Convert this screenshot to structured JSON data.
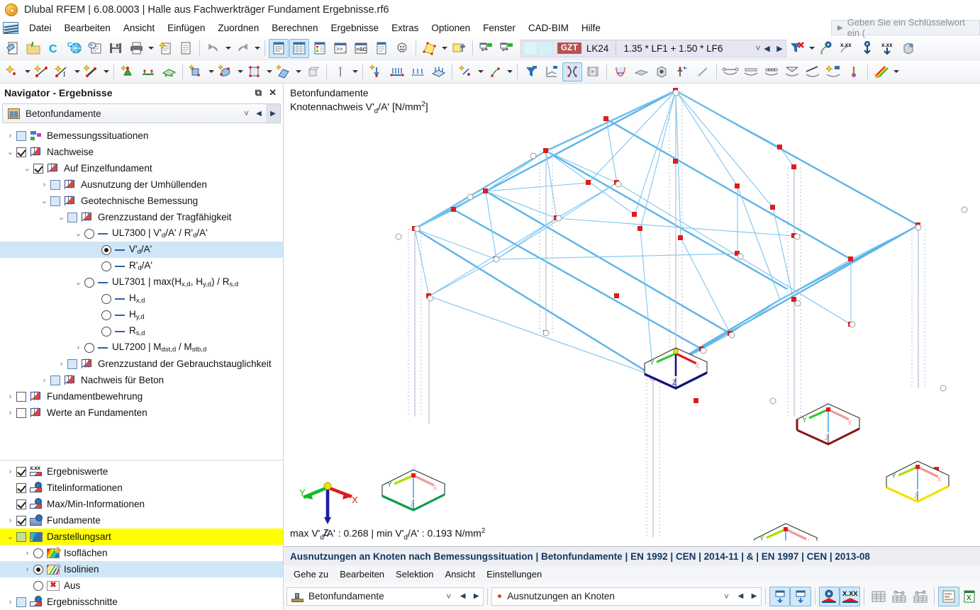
{
  "window": {
    "title": "Dlubal RFEM | 6.08.0003 | Halle aus Fachwerkträger Fundament Ergebnisse.rf6",
    "logo_icon": "dlubal-logo-icon"
  },
  "menubar": {
    "app_icon": "rfem-app-icon",
    "items": [
      "Datei",
      "Bearbeiten",
      "Ansicht",
      "Einfügen",
      "Zuordnen",
      "Berechnen",
      "Ergebnisse",
      "Extras",
      "Optionen",
      "Fenster",
      "CAD-BIM",
      "Hilfe"
    ],
    "search_placeholder": "Geben Sie ein Schlüsselwort ein ("
  },
  "toolbar1": {
    "icons": [
      "new-model-icon",
      "open-folder-icon",
      "connect-icon",
      "cloud-model-icon",
      "model-info-icon",
      "save-icon",
      "print-icon",
      "print-dropdown-caret",
      "new-report-icon",
      "document-icon",
      "undo-icon",
      "undo-dropdown-caret",
      "redo-icon",
      "redo-dropdown-caret",
      "navigator-panel-icon",
      "table-panel-icon",
      "colors-panel-icon",
      "console-icon",
      "script-icon",
      "list-panel-icon",
      "support-icon",
      "render-model-icon",
      "render-dropdown-caret",
      "loads-toggle-icon"
    ],
    "load_combo": {
      "category_badge": "GZT",
      "combination": "LK24",
      "formula": "1.35 * LF1 + 1.50 * LF6",
      "chevron": "chevron-down-icon",
      "prev": "prev-combination-icon",
      "next": "next-combination-icon"
    },
    "right_icons": [
      "filter-clear-icon",
      "filter-dropdown-caret",
      "visibility-icon",
      "values-icon",
      "down-arrow-icon",
      "values-down-icon",
      "render-solid-icon"
    ]
  },
  "toolbar2": {
    "icons": [
      "new-node-icon",
      "node-dropdown-caret",
      "new-line-icon",
      "line-dimension-icon",
      "line-dropdown-caret",
      "new-member-icon",
      "member-dropdown-caret",
      "nodal-support-icon",
      "line-support-icon",
      "surface-support-icon",
      "new-surface-icon",
      "surface-dropdown-caret",
      "new-solid-icon",
      "solid-dropdown-caret",
      "new-opening-icon",
      "opening-dropdown-caret",
      "new-member-set-icon",
      "member-set-dropdown-caret",
      "delete-object-icon",
      "thickness-icon",
      "thickness-dropdown-caret",
      "nodal-load-icon",
      "member-load-icon",
      "line-load-icon",
      "surface-load-icon",
      "free-load-icon",
      "free-load-dropdown-caret",
      "imperfection-icon",
      "imperfection-dropdown-caret",
      "filter-results-icon",
      "result-diagram-icon",
      "deformation-icon",
      "animation-icon",
      "internal-forces-icon",
      "surface-results-icon",
      "solid-results-icon",
      "support-reactions-icon",
      "line-result-icon",
      "result-beam-icon",
      "result-section-icon",
      "result-value-icon",
      "result-envelope-icon",
      "result-gradient-icon",
      "result-new-icon",
      "result-scale-icon",
      "color-scale-icon",
      "color-scale-dropdown-caret"
    ]
  },
  "navigator": {
    "title": "Navigator - Ergebnisse",
    "undock_icon": "undock-icon",
    "close_icon": "close-icon",
    "combo": {
      "icon": "concrete-foundation-icon",
      "value": "Betonfundamente",
      "chevron": "chevron-down-icon",
      "prev": "prev-icon",
      "next": "next-icon"
    },
    "tree": [
      {
        "label": "Bemessungssituationen",
        "indent": 0,
        "twist": "collapsed",
        "control": "checkbox",
        "state": "blue",
        "icon": "design-situation-icon"
      },
      {
        "label": "Nachweise",
        "indent": 0,
        "twist": "expanded",
        "control": "checkbox",
        "state": "checked",
        "icon": "design-check-icon"
      },
      {
        "label": "Auf Einzelfundament",
        "indent": 1,
        "twist": "expanded",
        "control": "checkbox",
        "state": "checked",
        "icon": "design-check-icon"
      },
      {
        "label": "Ausnutzung der Umhüllenden",
        "indent": 2,
        "twist": "collapsed",
        "control": "checkbox",
        "state": "blue",
        "icon": "design-check-icon"
      },
      {
        "label": "Geotechnische Bemessung",
        "indent": 2,
        "twist": "expanded",
        "control": "checkbox",
        "state": "blue",
        "icon": "design-check-icon"
      },
      {
        "label": "Grenzzustand der Tragfähigkeit",
        "indent": 3,
        "twist": "expanded",
        "control": "checkbox",
        "state": "blue",
        "icon": "design-check-icon"
      },
      {
        "label": "UL7300 | V'd/A' / R'd/A'",
        "indent": 4,
        "twist": "expanded",
        "control": "radio",
        "state": "off",
        "icon": "line-dash-icon"
      },
      {
        "label": "V'd/A'",
        "indent": 5,
        "twist": "none",
        "control": "radio",
        "state": "on",
        "icon": "line-dash-icon",
        "selected": true
      },
      {
        "label": "R'd/A'",
        "indent": 5,
        "twist": "none",
        "control": "radio",
        "state": "off",
        "icon": "line-dash-icon"
      },
      {
        "label": "UL7301 | max(Hx,d, Hy,d) / Rs,d",
        "indent": 4,
        "twist": "expanded",
        "control": "radio",
        "state": "off",
        "icon": "line-dash-icon"
      },
      {
        "label": "Hx,d",
        "indent": 5,
        "twist": "none",
        "control": "radio",
        "state": "off",
        "icon": "line-dash-icon"
      },
      {
        "label": "Hy,d",
        "indent": 5,
        "twist": "none",
        "control": "radio",
        "state": "off",
        "icon": "line-dash-icon"
      },
      {
        "label": "Rs,d",
        "indent": 5,
        "twist": "none",
        "control": "radio",
        "state": "off",
        "icon": "line-dash-icon"
      },
      {
        "label": "UL7200 | Mdst,d / Mstb,d",
        "indent": 4,
        "twist": "collapsed",
        "control": "radio",
        "state": "off",
        "icon": "line-dash-icon"
      },
      {
        "label": "Grenzzustand der Gebrauchstauglichkeit",
        "indent": 3,
        "twist": "collapsed",
        "control": "checkbox",
        "state": "blue",
        "icon": "design-check-icon"
      },
      {
        "label": "Nachweis für Beton",
        "indent": 2,
        "twist": "collapsed",
        "control": "checkbox",
        "state": "blue",
        "icon": "design-check-icon"
      },
      {
        "label": "Fundamentbewehrung",
        "indent": 0,
        "twist": "collapsed",
        "control": "checkbox",
        "state": "off",
        "icon": "design-check-icon"
      },
      {
        "label": "Werte an Fundamenten",
        "indent": 0,
        "twist": "collapsed",
        "control": "checkbox",
        "state": "off",
        "icon": "design-check-icon"
      }
    ],
    "tree_bottom": [
      {
        "label": "Ergebniswerte",
        "indent": 0,
        "twist": "collapsed",
        "control": "checkbox",
        "state": "checked",
        "icon": "result-values-icon"
      },
      {
        "label": "Titelinformationen",
        "indent": 0,
        "twist": "none",
        "control": "checkbox",
        "state": "checked",
        "icon": "title-info-icon"
      },
      {
        "label": "Max/Min-Informationen",
        "indent": 0,
        "twist": "none",
        "control": "checkbox",
        "state": "checked",
        "icon": "maxmin-info-icon"
      },
      {
        "label": "Fundamente",
        "indent": 0,
        "twist": "collapsed",
        "control": "checkbox",
        "state": "checked",
        "icon": "foundations-icon"
      },
      {
        "label": "Darstellungsart",
        "indent": 0,
        "twist": "expanded",
        "control": "checkbox",
        "state": "green",
        "icon": "display-type-icon",
        "highlight": true
      },
      {
        "label": "Isoflächen",
        "indent": 1,
        "twist": "collapsed",
        "control": "radio",
        "state": "off",
        "icon": "isosurfaces-icon"
      },
      {
        "label": "Isolinien",
        "indent": 1,
        "twist": "collapsed",
        "control": "radio",
        "state": "on",
        "icon": "isolines-icon",
        "selected": true
      },
      {
        "label": "Aus",
        "indent": 1,
        "twist": "none",
        "control": "radio",
        "state": "off",
        "icon": "off-x-icon"
      },
      {
        "label": "Ergebnisschnitte",
        "indent": 0,
        "twist": "collapsed",
        "control": "checkbox",
        "state": "blue",
        "icon": "result-sections-icon"
      }
    ]
  },
  "canvas": {
    "caption_line1": "Betonfundamente",
    "caption_line2_prefix": "Knotennachweis V'",
    "caption_line2_sub": "d",
    "caption_line2_mid": "/A' [N/mm",
    "caption_line2_sup": "2",
    "caption_line2_suffix": "]",
    "maxmin_prefix": "max V'",
    "maxmin_sub1": "d",
    "maxmin_mid1": "/A' : 0.268 | min V'",
    "maxmin_sub2": "d",
    "maxmin_mid2": "/A' : 0.193 N/mm",
    "maxmin_sup": "2",
    "max_value": "0.268",
    "min_value": "0.193",
    "unit": "N/mm2",
    "axes": {
      "x": "X",
      "y": "Y",
      "z": "Z"
    },
    "axis_colors": {
      "x": "#e01b1b",
      "y": "#11bb22",
      "z": "#1a1f9e"
    },
    "member_color": "#5cb4e8",
    "node_color": "#e01b1b"
  },
  "result_panel": {
    "title": "Ausnutzungen an Knoten nach Bemessungssituation | Betonfundamente | EN 1992 | CEN | 2014-11 | & | EN 1997 | CEN | 2013-08",
    "menu": [
      "Gehe zu",
      "Bearbeiten",
      "Selektion",
      "Ansicht",
      "Einstellungen"
    ],
    "combo_left": {
      "icon": "foundation-icon",
      "value": "Betonfundamente",
      "chevron": "chevron-down-icon",
      "prev": "prev-icon",
      "next": "next-icon"
    },
    "combo_right": {
      "bullet": "red-dot-icon",
      "value": "Ausnutzungen an Knoten",
      "chevron": "chevron-down-icon",
      "prev": "prev-icon",
      "next": "next-icon"
    },
    "buttons": [
      "select-in-table-icon",
      "select-in-model-icon",
      "show-results-icon",
      "show-values-icon",
      "table-full-icon",
      "table-row-icon",
      "table-col-icon",
      "bar-chart-icon",
      "excel-export-icon"
    ]
  },
  "colors": {
    "accent": "#2b6fb5",
    "highlight": "#ffff00",
    "selection": "#cfe6f7",
    "gzt_badge": "#b5534f"
  }
}
